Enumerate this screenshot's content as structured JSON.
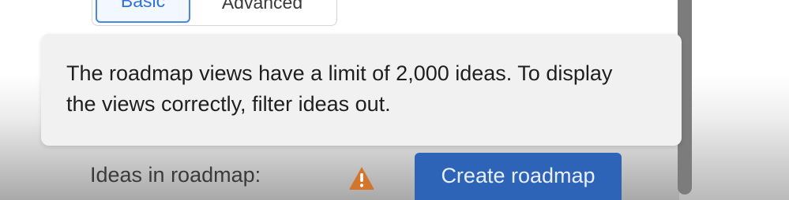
{
  "toggle": {
    "basic_label": "Basic",
    "advanced_label": "Advanced"
  },
  "tooltip": {
    "text": "The roadmap views have a limit of 2,000 ideas. To display the views correctly, filter ideas out."
  },
  "footer": {
    "ideas_label": "Ideas in roadmap:",
    "warning_icon": "warning-triangle-icon",
    "create_button_label": "Create roadmap"
  },
  "colors": {
    "accent": "#2e64b8",
    "selected_tab": "#4a86e8",
    "warning": "#d3752a"
  }
}
